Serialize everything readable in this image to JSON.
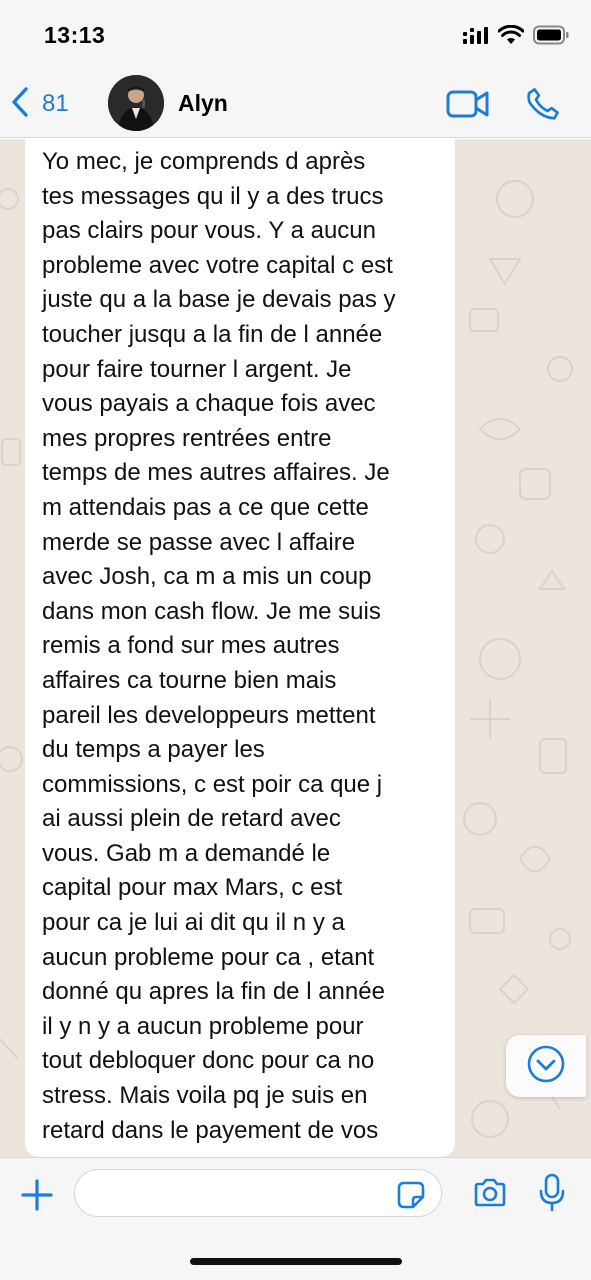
{
  "status_bar": {
    "time": "13:13",
    "icons": [
      "signal-icon",
      "wifi-icon",
      "battery-icon"
    ]
  },
  "header": {
    "back_count": "81",
    "contact_name": "Alyn",
    "icons": [
      "chevron-left-icon",
      "video-call-icon",
      "phone-icon"
    ]
  },
  "message": {
    "text": "Yo mec, je comprends d après\ntes messages qu il y a des trucs\npas clairs pour vous. Y a aucun\nprobleme avec votre capital c est\njuste qu a la base je devais pas y\ntoucher jusqu a la fin de l année\npour faire tourner l argent. Je\nvous payais a chaque fois avec\nmes propres rentrées entre\ntemps de mes autres affaires. Je\nm attendais pas a ce que cette\nmerde se passe avec l affaire\navec Josh, ca m a mis un coup\ndans mon cash flow. Je me suis\nremis a fond sur mes autres\naffaires ca tourne bien mais\npareil les developpeurs mettent\ndu temps a payer les\ncommissions,  c est poir ca que j\nai aussi plein de retard avec\nvous. Gab m a demandé le\ncapital pour max Mars, c est\npour ca je lui ai dit qu il n y a\naucun probleme pour ca , etant\ndonné qu apres la fin de l année\nil y n y a aucun probleme pour\ntout debloquer donc pour ca no\nstress. Mais voila pq je suis en\nretard dans le payement de vos"
  },
  "input_bar": {
    "value": "",
    "icons": [
      "plus-icon",
      "sticker-icon",
      "camera-icon",
      "microphone-icon"
    ]
  },
  "colors": {
    "accent": "#1c7cd8",
    "chat_background": "#ece5dd",
    "bar_background": "#f6f6f6",
    "bubble": "#ffffff"
  }
}
